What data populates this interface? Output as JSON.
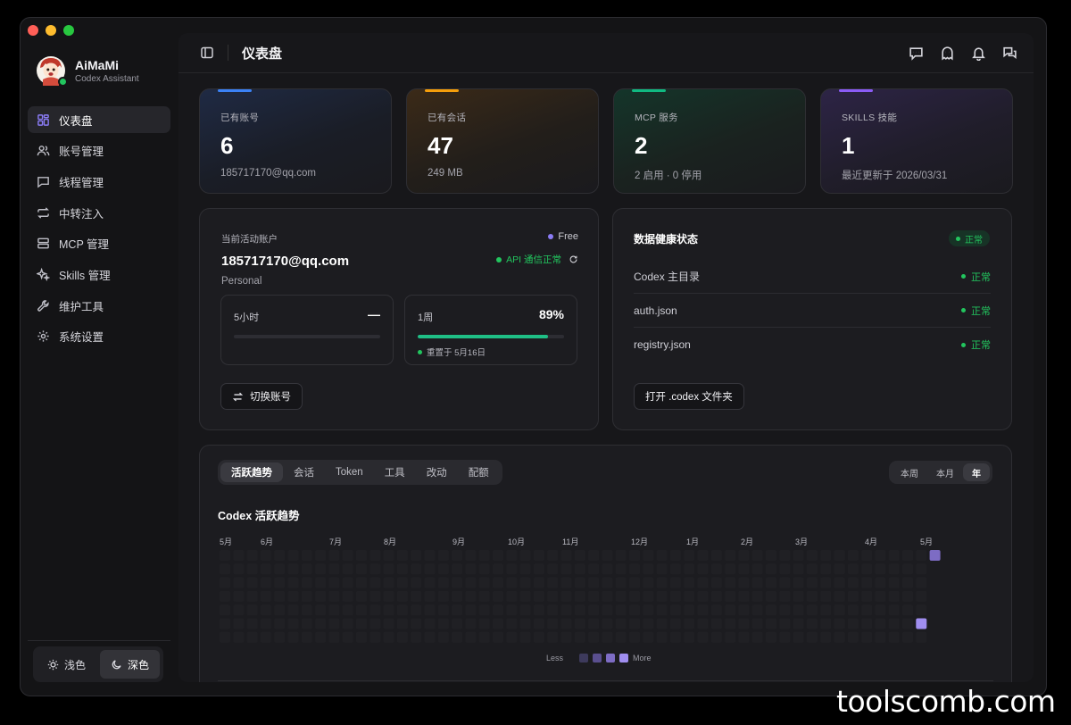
{
  "brand": {
    "name": "AiMaMi",
    "subtitle": "Codex Assistant"
  },
  "sidebar": {
    "items": [
      {
        "label": "仪表盘",
        "icon": "dashboard-icon",
        "active": true
      },
      {
        "label": "账号管理",
        "icon": "users-icon"
      },
      {
        "label": "线程管理",
        "icon": "chat-icon"
      },
      {
        "label": "中转注入",
        "icon": "repeat-icon"
      },
      {
        "label": "MCP 管理",
        "icon": "server-icon"
      },
      {
        "label": "Skills 管理",
        "icon": "sparkles-icon"
      },
      {
        "label": "维护工具",
        "icon": "wrench-icon"
      },
      {
        "label": "系统设置",
        "icon": "gear-icon"
      }
    ],
    "theme": {
      "light": "浅色",
      "dark": "深色",
      "selected": "dark"
    }
  },
  "header": {
    "title": "仪表盘"
  },
  "stats": [
    {
      "label": "已有账号",
      "value": "6",
      "sub": "185717170@qq.com",
      "accent": "#3b82f6"
    },
    {
      "label": "已有会话",
      "value": "47",
      "sub": "249 MB",
      "accent": "#f59e0b"
    },
    {
      "label": "MCP 服务",
      "value": "2",
      "sub": "2 启用 · 0 停用",
      "accent": "#10b981"
    },
    {
      "label": "SKILLS 技能",
      "value": "1",
      "sub": "最近更新于 2026/03/31",
      "accent": "#8b5cf6"
    }
  ],
  "account": {
    "label": "当前活动账户",
    "email": "185717170@qq.com",
    "type": "Personal",
    "plan": "Free",
    "api_status": "API 通信正常",
    "quota": [
      {
        "title": "5小时",
        "value": "—",
        "fraction": 0
      },
      {
        "title": "1周",
        "value": "89%",
        "fraction": 0.89,
        "reset": "重置于 5月16日"
      }
    ],
    "switch_label": "切换账号"
  },
  "health": {
    "title": "数据健康状态",
    "status": "正常",
    "rows": [
      {
        "name": "Codex 主目录",
        "status": "正常"
      },
      {
        "name": "auth.json",
        "status": "正常"
      },
      {
        "name": "registry.json",
        "status": "正常"
      }
    ],
    "open_label": "打开 .codex 文件夹"
  },
  "activity": {
    "tabs": [
      "活跃趋势",
      "会话",
      "Token",
      "工具",
      "改动",
      "配额"
    ],
    "selected_tab": "活跃趋势",
    "ranges": [
      "本周",
      "本月",
      "年"
    ],
    "selected_range": "年",
    "chart_title": "Codex 活跃趋势",
    "legend_less": "Less",
    "legend_more": "More",
    "legend_colors": [
      "#3d3a5c",
      "#5a4f8f",
      "#7d6cc4",
      "#a08ef0"
    ]
  },
  "chart_data": {
    "type": "heatmap",
    "title": "Codex 活跃趋势",
    "x_labels": [
      "5月",
      "6月",
      "7月",
      "8月",
      "9月",
      "10月",
      "11月",
      "12月",
      "1月",
      "2月",
      "3月",
      "4月",
      "5月"
    ],
    "y_labels": [],
    "weeks": 53,
    "days_per_week": 7,
    "active_cells": [
      {
        "week": 52,
        "day": 0,
        "level": 2
      },
      {
        "week": 51,
        "day": 5,
        "level": 3
      }
    ]
  },
  "watermark": "toolscomb.com"
}
